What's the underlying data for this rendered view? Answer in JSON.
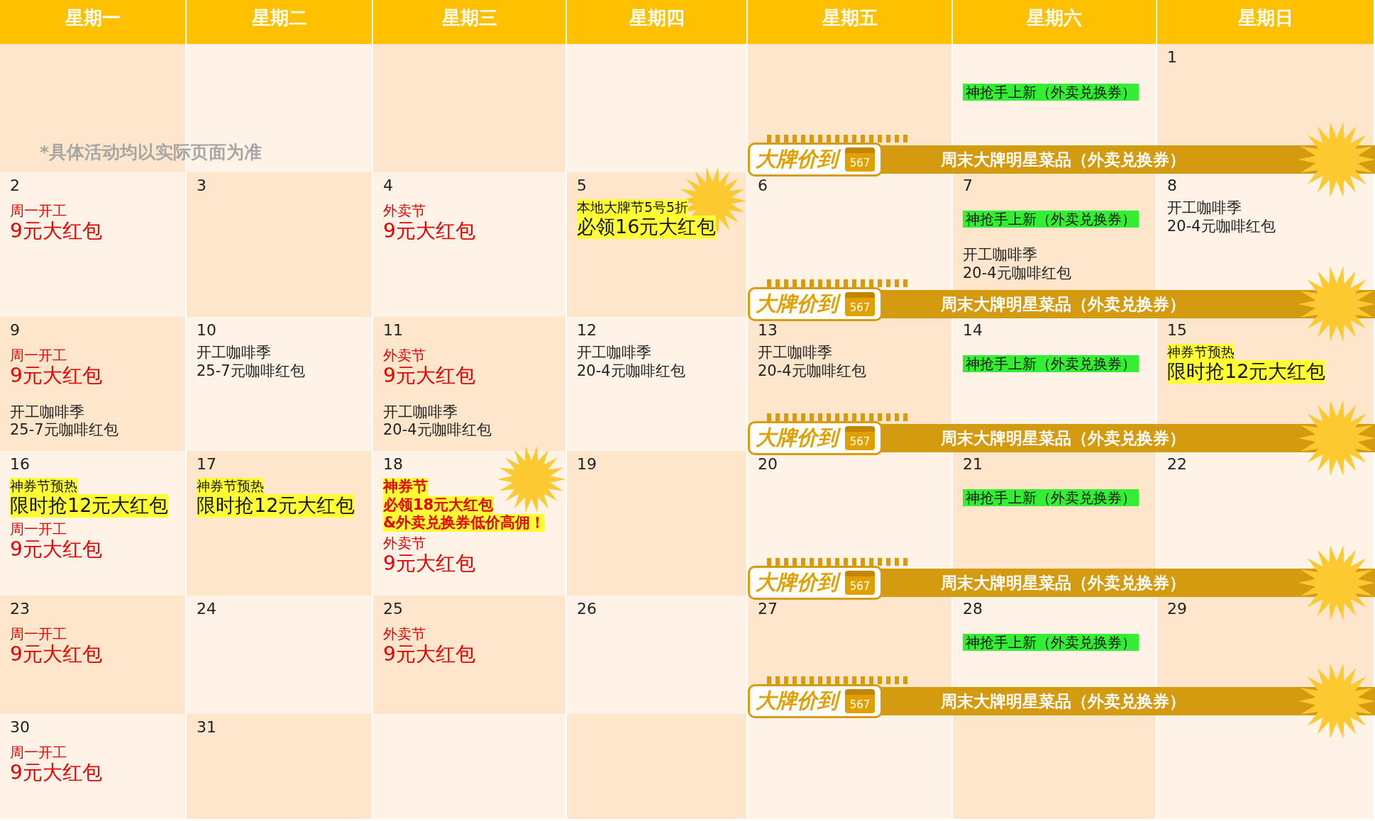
{
  "weekdays": [
    "星期一",
    "星期二",
    "星期三",
    "星期四",
    "星期五",
    "星期六",
    "星期日"
  ],
  "weeks": [
    {
      "note": "*具体活动均以实际页面为准",
      "banner": {
        "brand": "大牌价到",
        "icon_number": "567",
        "text": "周末大牌明星菜品（外卖兑换券）"
      },
      "days": [
        {
          "kind": "blank"
        },
        {
          "kind": "blank"
        },
        {
          "kind": "blank"
        },
        {
          "kind": "blank"
        },
        {
          "kind": "blank"
        },
        {
          "kind": "blank",
          "events": [
            {
              "kind": "green",
              "text": "神抢手上新（外卖兑换券）"
            }
          ]
        },
        {
          "kind": "date",
          "day": "1"
        }
      ]
    },
    {
      "banner": {
        "brand": "大牌价到",
        "icon_number": "567",
        "text": "周末大牌明星菜品（外卖兑换券）"
      },
      "days": [
        {
          "kind": "date",
          "day": "2",
          "events": [
            {
              "kind": "label",
              "text": "周一开工"
            },
            {
              "kind": "title",
              "text": "9元大红包"
            }
          ]
        },
        {
          "kind": "date",
          "day": "3"
        },
        {
          "kind": "date",
          "day": "4",
          "events": [
            {
              "kind": "label",
              "text": "外卖节"
            },
            {
              "kind": "title",
              "text": "9元大红包"
            }
          ]
        },
        {
          "kind": "date",
          "day": "5",
          "burst": true,
          "events": [
            {
              "kind": "hl-label",
              "text": "本地大牌节5号5折"
            },
            {
              "kind": "hl-title",
              "text": "必领16元大红包"
            }
          ]
        },
        {
          "kind": "date",
          "day": "6"
        },
        {
          "kind": "date",
          "day": "7",
          "events": [
            {
              "kind": "green",
              "text": "神抢手上新（外卖兑换券）"
            },
            {
              "kind": "note",
              "text": "开工咖啡季"
            },
            {
              "kind": "note",
              "text": "20-4元咖啡红包"
            }
          ]
        },
        {
          "kind": "date",
          "day": "8",
          "events": [
            {
              "kind": "note",
              "text": "开工咖啡季"
            },
            {
              "kind": "note",
              "text": "20-4元咖啡红包"
            }
          ]
        }
      ]
    },
    {
      "banner": {
        "brand": "大牌价到",
        "icon_number": "567",
        "text": "周末大牌明星菜品（外卖兑换券）"
      },
      "days": [
        {
          "kind": "date",
          "day": "9",
          "events": [
            {
              "kind": "label",
              "text": "周一开工"
            },
            {
              "kind": "title",
              "text": "9元大红包"
            },
            {
              "kind": "note",
              "text": "开工咖啡季"
            },
            {
              "kind": "note",
              "text": "25-7元咖啡红包"
            }
          ]
        },
        {
          "kind": "date",
          "day": "10",
          "events": [
            {
              "kind": "note",
              "text": "开工咖啡季"
            },
            {
              "kind": "note",
              "text": "25-7元咖啡红包"
            }
          ]
        },
        {
          "kind": "date",
          "day": "11",
          "events": [
            {
              "kind": "label",
              "text": "外卖节"
            },
            {
              "kind": "title",
              "text": "9元大红包"
            },
            {
              "kind": "note",
              "text": "开工咖啡季"
            },
            {
              "kind": "note",
              "text": "20-4元咖啡红包"
            }
          ]
        },
        {
          "kind": "date",
          "day": "12",
          "events": [
            {
              "kind": "note",
              "text": "开工咖啡季"
            },
            {
              "kind": "note",
              "text": "20-4元咖啡红包"
            }
          ]
        },
        {
          "kind": "date",
          "day": "13",
          "events": [
            {
              "kind": "note",
              "text": "开工咖啡季"
            },
            {
              "kind": "note",
              "text": "20-4元咖啡红包"
            }
          ]
        },
        {
          "kind": "date",
          "day": "14",
          "events": [
            {
              "kind": "green",
              "text": "神抢手上新（外卖兑换券）"
            }
          ]
        },
        {
          "kind": "date",
          "day": "15",
          "events": [
            {
              "kind": "hl-label",
              "text": "神券节预热"
            },
            {
              "kind": "hl-title",
              "text": "限时抢12元大红包"
            }
          ]
        }
      ]
    },
    {
      "banner": {
        "brand": "大牌价到",
        "icon_number": "567",
        "text": "周末大牌明星菜品（外卖兑换券）"
      },
      "days": [
        {
          "kind": "date",
          "day": "16",
          "events": [
            {
              "kind": "hl-label",
              "text": "神券节预热"
            },
            {
              "kind": "hl-title",
              "text": "限时抢12元大红包"
            },
            {
              "kind": "label",
              "text": "周一开工"
            },
            {
              "kind": "title",
              "text": "9元大红包"
            }
          ]
        },
        {
          "kind": "date",
          "day": "17",
          "events": [
            {
              "kind": "hl-label",
              "text": "神券节预热"
            },
            {
              "kind": "hl-title",
              "text": "限时抢12元大红包"
            }
          ]
        },
        {
          "kind": "date",
          "day": "18",
          "burst": true,
          "events": [
            {
              "kind": "hl-red",
              "text": "神券节"
            },
            {
              "kind": "hl-red",
              "text": "必领18元大红包"
            },
            {
              "kind": "hl-red",
              "text": "&外卖兑换券低价高佣！"
            },
            {
              "kind": "label",
              "text": "外卖节"
            },
            {
              "kind": "title",
              "text": "9元大红包"
            }
          ]
        },
        {
          "kind": "date",
          "day": "19"
        },
        {
          "kind": "date",
          "day": "20"
        },
        {
          "kind": "date",
          "day": "21",
          "events": [
            {
              "kind": "green",
              "text": "神抢手上新（外卖兑换券）"
            }
          ]
        },
        {
          "kind": "date",
          "day": "22"
        }
      ]
    },
    {
      "banner": {
        "brand": "大牌价到",
        "icon_number": "567",
        "text": "周末大牌明星菜品（外卖兑换券）"
      },
      "days": [
        {
          "kind": "date",
          "day": "23",
          "events": [
            {
              "kind": "label",
              "text": "周一开工"
            },
            {
              "kind": "title",
              "text": "9元大红包"
            }
          ]
        },
        {
          "kind": "date",
          "day": "24"
        },
        {
          "kind": "date",
          "day": "25",
          "events": [
            {
              "kind": "label",
              "text": "外卖节"
            },
            {
              "kind": "title",
              "text": "9元大红包"
            }
          ]
        },
        {
          "kind": "date",
          "day": "26"
        },
        {
          "kind": "date",
          "day": "27"
        },
        {
          "kind": "date",
          "day": "28",
          "events": [
            {
              "kind": "green",
              "text": "神抢手上新（外卖兑换券）"
            }
          ]
        },
        {
          "kind": "date",
          "day": "29"
        }
      ]
    },
    {
      "days": [
        {
          "kind": "date",
          "day": "30",
          "events": [
            {
              "kind": "label",
              "text": "周一开工"
            },
            {
              "kind": "title",
              "text": "9元大红包"
            }
          ]
        },
        {
          "kind": "date",
          "day": "31"
        },
        {
          "kind": "blank"
        },
        {
          "kind": "blank"
        },
        {
          "kind": "blank"
        },
        {
          "kind": "blank"
        },
        {
          "kind": "blank"
        }
      ]
    }
  ]
}
